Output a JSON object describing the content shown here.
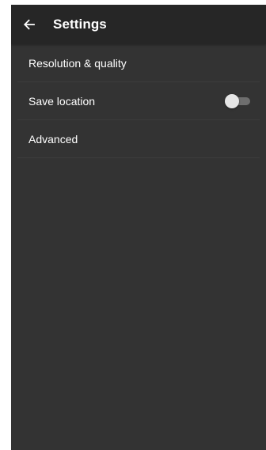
{
  "app_bar": {
    "back_icon": "arrow-left-icon",
    "title": "Settings"
  },
  "settings": {
    "items": [
      {
        "label": "Resolution & quality"
      },
      {
        "label": "Save location",
        "toggle_on": false
      },
      {
        "label": "Advanced"
      }
    ]
  },
  "colors": {
    "background": "#333333",
    "app_bar": "#262626",
    "text": "#ffffff",
    "toggle_track_off": "#6e6e6e",
    "toggle_thumb_off": "#e6e6e6"
  }
}
